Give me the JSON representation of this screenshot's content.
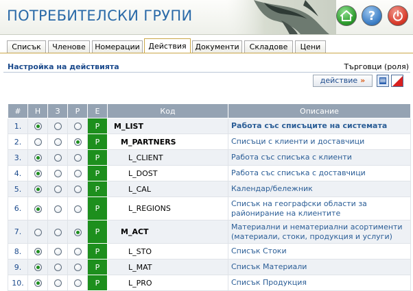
{
  "app": {
    "title": "ПОТРЕБИТЕЛСКИ ГРУПИ"
  },
  "header_icons": [
    "home-icon",
    "help-icon",
    "power-icon"
  ],
  "tabs": [
    {
      "label": "Списък",
      "active": false
    },
    {
      "label": "Членове",
      "active": false
    },
    {
      "label": "Номерации",
      "active": false
    },
    {
      "label": "Действия",
      "active": true
    },
    {
      "label": "Документи",
      "active": false
    },
    {
      "label": "Складове",
      "active": false
    },
    {
      "label": "Цени",
      "active": false
    }
  ],
  "section": {
    "title": "Настройка на действията",
    "role": "Търговци (роля)"
  },
  "toolbar": {
    "action_label": "действие",
    "action_arrow": "»",
    "print_icon": "print-icon",
    "clear_icon": "clear-icon"
  },
  "table": {
    "headers": [
      "#",
      "Н",
      "З",
      "Р",
      "Е",
      "Код",
      "Описание"
    ],
    "rows": [
      {
        "num": "1.",
        "choice": "Н",
        "e": "Р",
        "code": "M_LIST",
        "level": 0,
        "desc": "Работа със списъците на системата"
      },
      {
        "num": "2.",
        "choice": "Р",
        "e": "Р",
        "code": "M_PARTNERS",
        "level": 1,
        "desc": "Списъци с клиенти и доставчици"
      },
      {
        "num": "3.",
        "choice": "Н",
        "e": "Р",
        "code": "L_CLIENT",
        "level": 2,
        "desc": "Работа със списъка с клиенти"
      },
      {
        "num": "4.",
        "choice": "Н",
        "e": "Р",
        "code": "L_DOST",
        "level": 2,
        "desc": "Работа със списъка с доставчици"
      },
      {
        "num": "5.",
        "choice": "Н",
        "e": "Р",
        "code": "L_CAL",
        "level": 2,
        "desc": "Календар/бележник"
      },
      {
        "num": "6.",
        "choice": "Н",
        "e": "Р",
        "code": "L_REGIONS",
        "level": 2,
        "desc": "Списък на географски области за районирание на клиентите"
      },
      {
        "num": "7.",
        "choice": "Р",
        "e": "Р",
        "code": "M_ACT",
        "level": 1,
        "desc": "Материални и нематериални асортименти (материали, стоки, продукция и услуги)"
      },
      {
        "num": "8.",
        "choice": "Н",
        "e": "Р",
        "code": "L_STO",
        "level": 2,
        "desc": "Списък Стоки"
      },
      {
        "num": "9.",
        "choice": "Н",
        "e": "Р",
        "code": "L_MAT",
        "level": 2,
        "desc": "Списък Материали"
      },
      {
        "num": "10.",
        "choice": "Н",
        "e": "Р",
        "code": "L_PRO",
        "level": 2,
        "desc": "Списък Продукция"
      }
    ]
  },
  "colors": {
    "accent": "#2a6aa8",
    "header_bg": "#95a3b3",
    "enabled": "#1d8f1d",
    "tab_border": "#c9a545"
  }
}
